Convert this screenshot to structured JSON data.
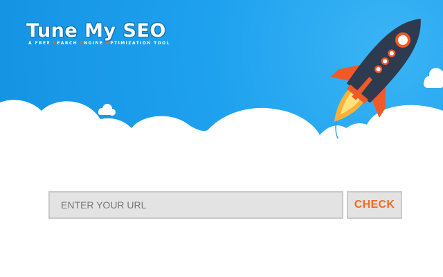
{
  "header": {
    "logo_title": "Tune My SEO",
    "tagline": [
      {
        "text": "A FREE ",
        "accent": false
      },
      {
        "text": "S",
        "accent": true
      },
      {
        "text": "EARCH ",
        "accent": false
      },
      {
        "text": "E",
        "accent": true
      },
      {
        "text": "NGINE ",
        "accent": false
      },
      {
        "text": "O",
        "accent": true
      },
      {
        "text": "PTIMIZATION TOOL",
        "accent": false
      }
    ]
  },
  "form": {
    "url_placeholder": "ENTER YOUR URL",
    "url_value": "",
    "check_label": "CHECK"
  },
  "colors": {
    "sky": "#1ea1ee",
    "accent": "#f26a21",
    "rocket_body": "#2e3b4e",
    "rocket_fins": "#f05a28",
    "flame": "#fbb03b"
  },
  "icons": {
    "rocket": "rocket-icon",
    "cloud": "cloud-icon"
  }
}
